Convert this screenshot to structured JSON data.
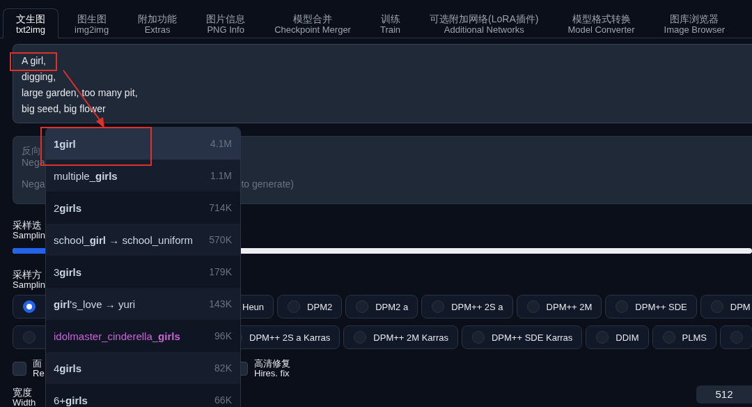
{
  "tabs": [
    {
      "label": "文生图",
      "sublabel": "txt2img",
      "selected": true
    },
    {
      "label": "图生图",
      "sublabel": "img2img",
      "selected": false
    },
    {
      "label": "附加功能",
      "sublabel": "Extras",
      "selected": false
    },
    {
      "label": "图片信息",
      "sublabel": "PNG Info",
      "selected": false
    },
    {
      "label": "模型合并",
      "sublabel": "Checkpoint Merger",
      "selected": false
    },
    {
      "label": "训练",
      "sublabel": "Train",
      "selected": false
    },
    {
      "label": "可选附加网络(LoRA插件)",
      "sublabel": "Additional Networks",
      "selected": false
    },
    {
      "label": "模型格式转换",
      "sublabel": "Model Converter",
      "selected": false
    },
    {
      "label": "图库浏览器",
      "sublabel": "Image Browser",
      "selected": false
    }
  ],
  "prompt": {
    "lines": [
      "A girl,",
      "digging,",
      "large garden, too many pit,",
      "big seed, big flower"
    ]
  },
  "negative_prompt": {
    "label": "反向",
    "sublabel": "Nega",
    "placeholder": "Nega",
    "placeholder_end": "to generate)"
  },
  "sampling_steps": {
    "label": "采样迭",
    "sublabel": "Samplin",
    "level": 0.13
  },
  "sampling_method": {
    "label": "采样方",
    "sublabel": "Samplin",
    "options": [
      {
        "selected": true
      },
      {
        "label": "Heun"
      },
      {
        "label": "DPM2",
        "selected": false
      },
      {
        "label": "DPM2 a",
        "selected": false
      },
      {
        "label": "DPM++ 2S a",
        "selected": false
      },
      {
        "label": "DPM++ 2M",
        "selected": false
      },
      {
        "label": "DPM++ SDE",
        "selected": false
      },
      {
        "label": "DPM",
        "selected": false
      },
      {
        "selected": false
      },
      {
        "label": "DPM++ 2S a Karras"
      },
      {
        "label": "DPM++ 2M Karras",
        "selected": false
      },
      {
        "label": "DPM++ SDE Karras",
        "selected": false
      },
      {
        "label": "DDIM",
        "selected": false
      },
      {
        "label": "PLMS",
        "selected": false
      },
      {
        "selected": false
      }
    ]
  },
  "checkboxes": [
    {
      "label": "面",
      "sublabel": "Re",
      "checked": false
    },
    {
      "label": "高清修复",
      "sublabel": "Hires. fix",
      "checked": false
    }
  ],
  "width": {
    "label": "宽度",
    "sublabel": "Width",
    "value": "512"
  },
  "autocomplete": [
    {
      "tag": "**1girl**",
      "count": "4.1M",
      "color": "#c9d6e3",
      "selected": true
    },
    {
      "tag": "multiple_**girls**",
      "count": "1.1M",
      "color": "#c9d6e3",
      "selected": false
    },
    {
      "tag": "2**girls**",
      "count": "714K",
      "color": "#c9d6e3",
      "selected": false
    },
    {
      "tag": "school_**girl** → school_uniform",
      "count": "570K",
      "color": "#c9d6e3",
      "selected": false
    },
    {
      "tag": "3**girls**",
      "count": "179K",
      "color": "#c9d6e3",
      "selected": false
    },
    {
      "tag": "**girl**'s_love → yuri",
      "count": "143K",
      "color": "#c9d6e3",
      "selected": false
    },
    {
      "tag": "idolmaster_cinderella_**girls**",
      "count": "96K",
      "color": "#c766d6",
      "selected": false
    },
    {
      "tag": "4**girls**",
      "count": "82K",
      "color": "#c9d6e3",
      "selected": false
    },
    {
      "tag": "6+**girls**",
      "count": "66K",
      "color": "#c9d6e3",
      "selected": false
    }
  ]
}
